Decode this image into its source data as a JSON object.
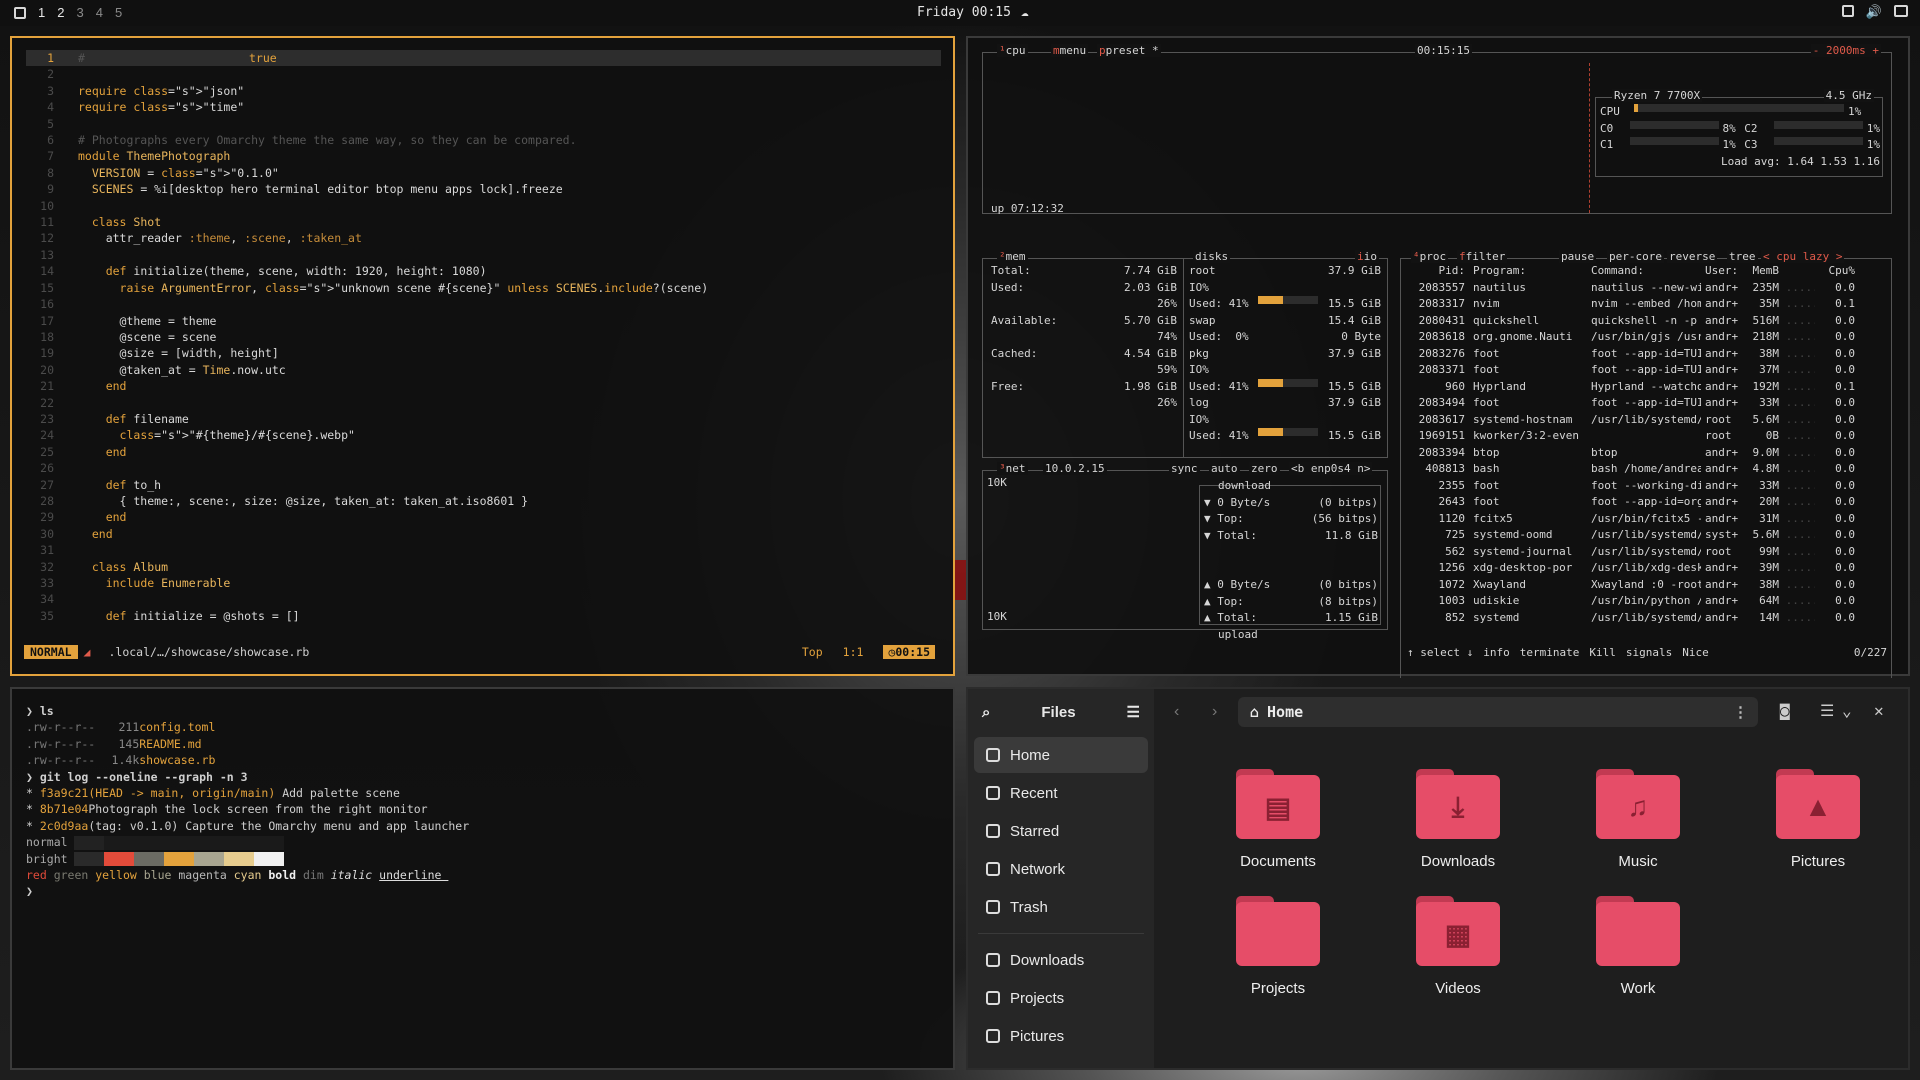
{
  "topbar": {
    "workspaces": [
      "1",
      "2",
      "3",
      "4",
      "5"
    ],
    "clock": "Friday 00:15"
  },
  "editor": {
    "lines": [
      {
        "n": "1",
        "html": "#"
      },
      {
        "n": "2",
        "html": ""
      },
      {
        "n": "3",
        "html": "require \"json\""
      },
      {
        "n": "4",
        "html": "require \"time\""
      },
      {
        "n": "5",
        "html": ""
      },
      {
        "n": "6",
        "html": "# Photographs every Omarchy theme the same way, so they can be compared."
      },
      {
        "n": "7",
        "html": "module ThemePhotograph"
      },
      {
        "n": "8",
        "html": "  VERSION = \"0.1.0\""
      },
      {
        "n": "9",
        "html": "  SCENES = %i[desktop hero terminal editor btop menu apps lock].freeze"
      },
      {
        "n": "10",
        "html": ""
      },
      {
        "n": "11",
        "html": "  class Shot"
      },
      {
        "n": "12",
        "html": "    attr_reader :theme, :scene, :taken_at"
      },
      {
        "n": "13",
        "html": ""
      },
      {
        "n": "14",
        "html": "    def initialize(theme, scene, width: 1920, height: 1080)"
      },
      {
        "n": "15",
        "html": "      raise ArgumentError, \"unknown scene #{scene}\" unless SCENES.include?(scene)"
      },
      {
        "n": "16",
        "html": ""
      },
      {
        "n": "17",
        "html": "      @theme = theme"
      },
      {
        "n": "18",
        "html": "      @scene = scene"
      },
      {
        "n": "19",
        "html": "      @size = [width, height]"
      },
      {
        "n": "20",
        "html": "      @taken_at = Time.now.utc"
      },
      {
        "n": "21",
        "html": "    end"
      },
      {
        "n": "22",
        "html": ""
      },
      {
        "n": "23",
        "html": "    def filename"
      },
      {
        "n": "24",
        "html": "      \"#{theme}/#{scene}.webp\""
      },
      {
        "n": "25",
        "html": "    end"
      },
      {
        "n": "26",
        "html": ""
      },
      {
        "n": "27",
        "html": "    def to_h"
      },
      {
        "n": "28",
        "html": "      { theme:, scene:, size: @size, taken_at: taken_at.iso8601 }"
      },
      {
        "n": "29",
        "html": "    end"
      },
      {
        "n": "30",
        "html": "  end"
      },
      {
        "n": "31",
        "html": ""
      },
      {
        "n": "32",
        "html": "  class Album"
      },
      {
        "n": "33",
        "html": "    include Enumerable"
      },
      {
        "n": "34",
        "html": ""
      },
      {
        "n": "35",
        "html": "    def initialize = @shots = []"
      }
    ],
    "inline_hint": "true",
    "mode": "NORMAL",
    "path": ".local/…/showcase/showcase.rb",
    "pos_top": "Top",
    "pos": "1:1",
    "time": "00:15"
  },
  "btop": {
    "cpu": {
      "label": "cpu",
      "menu": "menu",
      "preset": "preset *",
      "time": "00:15:15",
      "rate": "- 2000ms +",
      "uptime": "up 07:12:32",
      "model": "Ryzen 7 7700X",
      "freq": "4.5 GHz",
      "cpu_pct": "1%",
      "c0": "C0",
      "c0p": "8%",
      "c2": "C2",
      "c2p": "1%",
      "c1": "C1",
      "c1p": "1%",
      "c3": "C3",
      "c3p": "1%",
      "load": "Load avg: 1.64 1.53 1.16"
    },
    "mem": {
      "label": "mem",
      "total_l": "Total:",
      "total": "7.74 GiB",
      "used_l": "Used:",
      "used": "2.03 GiB",
      "used_p": "26%",
      "avail_l": "Available:",
      "avail": "5.70 GiB",
      "avail_p": "74%",
      "cached_l": "Cached:",
      "cached": "4.54 GiB",
      "cached_p": "59%",
      "free_l": "Free:",
      "free": "1.98 GiB",
      "free_p": "26%"
    },
    "disks": {
      "label": "disks",
      "io": "io",
      "root": "root",
      "root_size": "37.9 GiB",
      "io_l": "IO%",
      "used1": "Used: 41%",
      "used1_v": "15.5 GiB",
      "swap": "swap",
      "swap_v": "15.4 GiB",
      "swap_used": "Used:  0%",
      "swap_used_v": "0 Byte",
      "pkg": "pkg",
      "pkg_v": "37.9 GiB",
      "used2": "Used: 41%",
      "used2_v": "15.5 GiB",
      "log": "log",
      "log_v": "37.9 GiB",
      "used3": "Used: 41%",
      "used3_v": "15.5 GiB"
    },
    "net": {
      "label": "net",
      "ip": "10.0.2.15",
      "sync": "sync",
      "auto": "auto",
      "zero": "zero",
      "iface": "<b enp0s4 n>",
      "scale": "10K",
      "scale2": "10K",
      "download": "download",
      "dl_rate": "▼ 0 Byte/s",
      "dl_rate_b": "(0 bitps)",
      "dl_top": "▼ Top:",
      "dl_top_b": "(56 bitps)",
      "dl_total": "▼ Total:",
      "dl_total_v": "11.8 GiB",
      "ul_rate": "▲ 0 Byte/s",
      "ul_rate_b": "(0 bitps)",
      "ul_top": "▲ Top:",
      "ul_top_b": "(8 bitps)",
      "ul_total": "▲ Total:",
      "ul_total_v": "1.15 GiB",
      "upload": "upload"
    },
    "proc": {
      "label": "proc",
      "filter": "filter",
      "pause": "pause",
      "percore": "per-core",
      "reverse": "reverse",
      "tree": "tree",
      "sort": "< cpu lazy >",
      "headers": [
        "Pid:",
        "Program:",
        "Command:",
        "User:",
        "MemB",
        "Cpu%"
      ],
      "rows": [
        [
          "2083557",
          "nautilus",
          "nautilus --new-win",
          "andr+",
          "235M",
          "0.0"
        ],
        [
          "2083317",
          "nvim",
          "nvim --embed /home",
          "andr+",
          "35M",
          "0.1"
        ],
        [
          "2080431",
          "quickshell",
          "quickshell -n -p /",
          "andr+",
          "516M",
          "0.0"
        ],
        [
          "2083618",
          "org.gnome.Nauti",
          "/usr/bin/gjs /usr/",
          "andr+",
          "218M",
          "0.0"
        ],
        [
          "2083276",
          "foot",
          "foot --app-id=TUI.",
          "andr+",
          "38M",
          "0.0"
        ],
        [
          "2083371",
          "foot",
          "foot --app-id=TUI.",
          "andr+",
          "37M",
          "0.0"
        ],
        [
          "960",
          "Hyprland",
          "Hyprland --watchdo",
          "andr+",
          "192M",
          "0.1"
        ],
        [
          "2083494",
          "foot",
          "foot --app-id=TUI.",
          "andr+",
          "33M",
          "0.0"
        ],
        [
          "2083617",
          "systemd-hostnam",
          "/usr/lib/systemd/s",
          "root",
          "5.6M",
          "0.0"
        ],
        [
          "1969151",
          "kworker/3:2-even",
          "",
          "root",
          "0B",
          "0.0"
        ],
        [
          "2083394",
          "btop",
          "btop",
          "andr+",
          "9.0M",
          "0.0"
        ],
        [
          "408813",
          "bash",
          "bash /home/andreas",
          "andr+",
          "4.8M",
          "0.0"
        ],
        [
          "2355",
          "foot",
          "foot --working-dir",
          "andr+",
          "33M",
          "0.0"
        ],
        [
          "2643",
          "foot",
          "foot --app-id=org.",
          "andr+",
          "20M",
          "0.0"
        ],
        [
          "1120",
          "fcitx5",
          "/usr/bin/fcitx5 --",
          "andr+",
          "31M",
          "0.0"
        ],
        [
          "725",
          "systemd-oomd",
          "/usr/lib/systemd/s",
          "syst+",
          "5.6M",
          "0.0"
        ],
        [
          "562",
          "systemd-journal",
          "/usr/lib/systemd/s",
          "root",
          "99M",
          "0.0"
        ],
        [
          "1256",
          "xdg-desktop-por",
          "/usr/lib/xdg-deskt",
          "andr+",
          "39M",
          "0.0"
        ],
        [
          "1072",
          "Xwayland",
          "Xwayland :0 -rootl",
          "andr+",
          "38M",
          "0.0"
        ],
        [
          "1003",
          "udiskie",
          "/usr/bin/python /u",
          "andr+",
          "64M",
          "0.0"
        ],
        [
          "852",
          "systemd",
          "/usr/lib/systemd/s",
          "andr+",
          "14M",
          "0.0"
        ]
      ],
      "footer": [
        "↑ select ↓",
        "info",
        "terminate",
        "Kill",
        "signals",
        "Nice"
      ],
      "count": "0/227"
    }
  },
  "terminal": {
    "ls_cmd": "ls",
    "files": [
      {
        "perm": ".rw-r--r--",
        "size": "211",
        "name": "config.toml"
      },
      {
        "perm": ".rw-r--r--",
        "size": "145",
        "name": "README.md"
      },
      {
        "perm": ".rw-r--r--",
        "size": "1.4k",
        "name": "showcase.rb"
      }
    ],
    "git_cmd": "git log --oneline --graph -n 3",
    "commits": [
      {
        "hash": "f3a9c21",
        "ref": "(HEAD -> main, origin/main)",
        "msg": "Add palette scene"
      },
      {
        "hash": "8b71e04",
        "ref": "",
        "msg": "Photograph the lock screen from the right monitor"
      },
      {
        "hash": "2c0d9aa",
        "ref": "",
        "msg": "(tag: v0.1.0) Capture the Omarchy menu and app launcher"
      }
    ],
    "normal": "normal",
    "bright": "bright",
    "palette": [
      "#2a2a2a",
      "#e24b3a",
      "#6b6b63",
      "#e3a23c",
      "#a8a590",
      "#e6cc8e",
      "#efefef"
    ],
    "words": [
      "red",
      "green",
      "yellow",
      "blue",
      "magenta",
      "cyan",
      "bold",
      "dim",
      "italic",
      "underline"
    ]
  },
  "files": {
    "title": "Files",
    "location": "Home",
    "sidebar": [
      {
        "label": "Home",
        "icon": "home-icon"
      },
      {
        "label": "Recent",
        "icon": "clock-icon"
      },
      {
        "label": "Starred",
        "icon": "star-icon"
      },
      {
        "label": "Network",
        "icon": "network-icon"
      },
      {
        "label": "Trash",
        "icon": "trash-icon"
      }
    ],
    "bookmarks": [
      {
        "label": "Downloads",
        "icon": "download-icon"
      },
      {
        "label": "Projects",
        "icon": "folder-icon"
      },
      {
        "label": "Pictures",
        "icon": "image-icon"
      }
    ],
    "folders": [
      {
        "label": "Documents",
        "glyph": "▤"
      },
      {
        "label": "Downloads",
        "glyph": "⤓"
      },
      {
        "label": "Music",
        "glyph": "♫"
      },
      {
        "label": "Pictures",
        "glyph": "▲"
      },
      {
        "label": "Projects",
        "glyph": ""
      },
      {
        "label": "Videos",
        "glyph": "▦"
      },
      {
        "label": "Work",
        "glyph": ""
      }
    ]
  }
}
